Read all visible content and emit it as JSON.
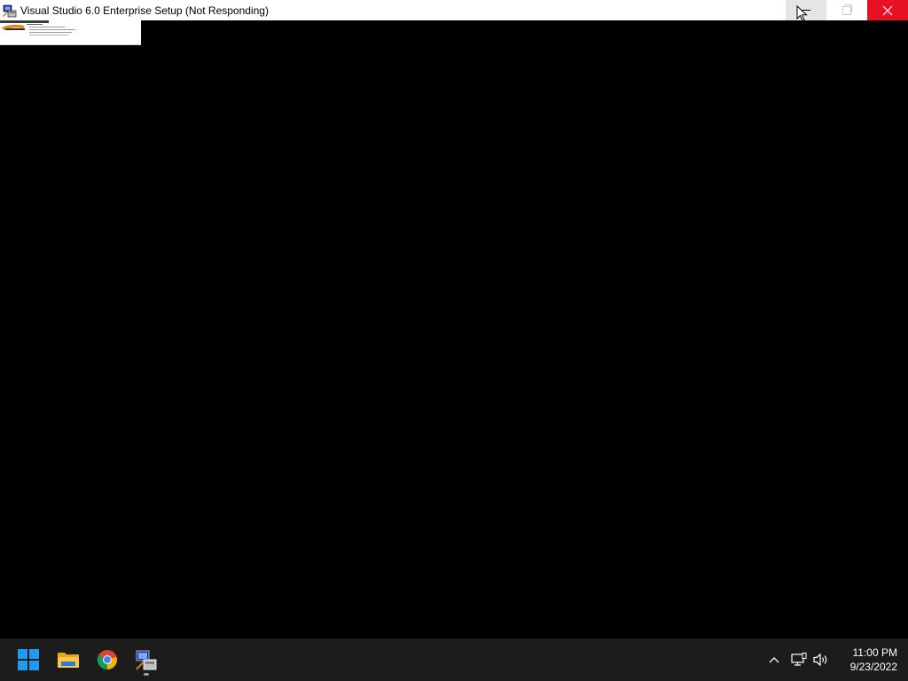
{
  "window": {
    "title": "Visual Studio 6.0 Enterprise Setup (Not Responding)",
    "controls": {
      "minimize_icon": "minimize-icon",
      "restore_icon": "restore-icon",
      "close_icon": "close-icon"
    }
  },
  "taskbar": {
    "apps": [
      {
        "name": "start-button",
        "icon": "windows-logo-icon"
      },
      {
        "name": "file-explorer",
        "icon": "folder-icon"
      },
      {
        "name": "chrome",
        "icon": "chrome-icon"
      },
      {
        "name": "visual-studio-setup",
        "icon": "setup-icon",
        "active": true
      }
    ],
    "tray": {
      "chevron_icon": "chevron-up-icon",
      "network_icon": "network-icon",
      "volume_icon": "volume-icon"
    },
    "clock": {
      "time": "11:00 PM",
      "date": "9/23/2022"
    }
  },
  "colors": {
    "close_button": "#e81123",
    "taskbar": "#1c1c1c",
    "background": "#000000",
    "windows_blue": "#0a84ff"
  }
}
